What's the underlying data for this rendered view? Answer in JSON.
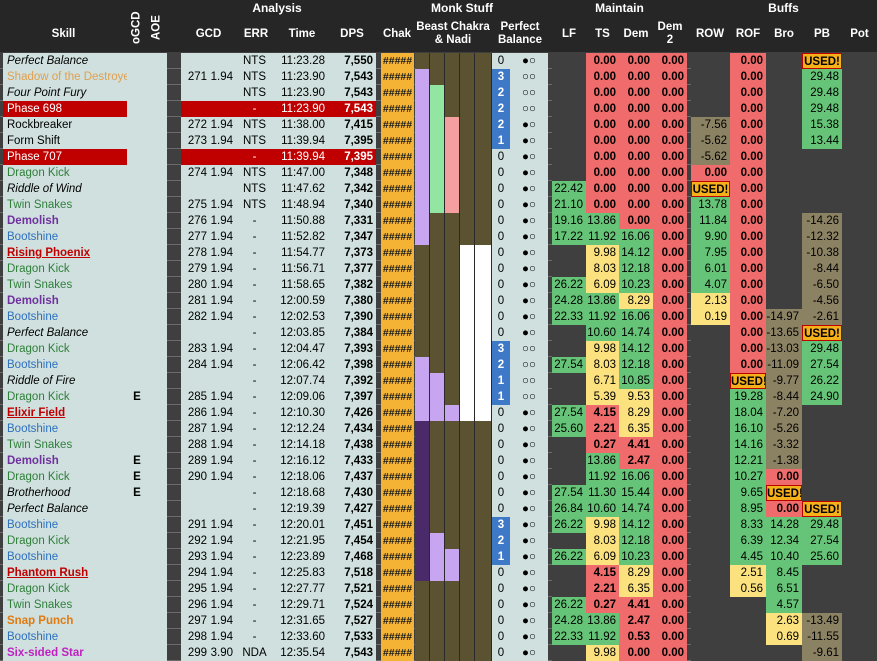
{
  "headers": {
    "groups": [
      "Analysis",
      "Monk Stuff",
      "Maintain",
      "Buffs"
    ],
    "skill": "Skill",
    "ogcd": "oGCD",
    "aoe": "AOE",
    "gcd": "GCD",
    "err": "ERR",
    "time": "Time",
    "dps": "DPS",
    "chak": "Chak",
    "beast": "Beast Chakra & Nadi",
    "perfect": "Perfect Balance",
    "lf": "LF",
    "ts": "TS",
    "dem": "Dem",
    "dem2": "Dem 2",
    "row": "ROW",
    "rof": "ROF",
    "bro": "Bro",
    "pb": "PB",
    "pot": "Pot"
  },
  "colors": {
    "phase": "#c00000",
    "red": "#f06b6b",
    "green": "#65c477",
    "gold": "#f5b335",
    "nadi_purple": "#c7a5f0",
    "nadi_green": "#93e6a2",
    "nadi_pink": "#f59fa0",
    "nadi_white": "#f2f2f2"
  },
  "rows": [
    {
      "skill": "Perfect Balance",
      "style": "italic",
      "ogcd": "",
      "gcdn": "",
      "gcd": "",
      "err": "NTS",
      "time": "11:23.28",
      "dps": "7,550",
      "chak": "#####",
      "nadi": [
        "",
        "",
        "",
        ""
      ],
      "pbn": "0",
      "pbd": "●○",
      "lf": "",
      "ts": "0.00",
      "dem": "0.00",
      "dem2": "0.00",
      "row": "",
      "rof": "0.00",
      "bro": "",
      "pb": "USED!",
      "pot": ""
    },
    {
      "skill": "Shadow of the Destroyer",
      "style": "shadow",
      "ogcd": "",
      "gcdn": "271",
      "gcd": "1.94",
      "err": "NTS",
      "time": "11:23.90",
      "dps": "7,543",
      "chak": "#####",
      "nadi": [
        "p",
        "",
        "",
        " "
      ],
      "pbn": "3",
      "pbd": "○○",
      "lf": "",
      "ts": "0.00",
      "dem": "0.00",
      "dem2": "0.00",
      "row": "",
      "rof": "0.00",
      "bro": "",
      "pb": "29.48",
      "pot": ""
    },
    {
      "skill": "Four Point Fury",
      "style": "italic",
      "ogcd": "",
      "gcdn": "",
      "gcd": "",
      "err": "NTS",
      "time": "11:23.90",
      "dps": "7,543",
      "chak": "#####",
      "nadi": [
        "p",
        "g",
        "",
        ""
      ],
      "pbn": "2",
      "pbd": "○○",
      "lf": "",
      "ts": "0.00",
      "dem": "0.00",
      "dem2": "0.00",
      "row": "",
      "rof": "0.00",
      "bro": "",
      "pb": "29.48",
      "pot": ""
    },
    {
      "skill": "Phase 698",
      "style": "phase",
      "ogcd": "",
      "gcdn": "",
      "gcd": "",
      "err": "-",
      "time": "11:23.90",
      "dps": "7,543",
      "chak": "#####",
      "nadi": [
        "p",
        "g",
        "",
        ""
      ],
      "pbn": "2",
      "pbd": "○○",
      "lf": "",
      "ts": "0.00",
      "dem": "0.00",
      "dem2": "0.00",
      "row": "",
      "rof": "0.00",
      "bro": "",
      "pb": "29.48",
      "pot": ""
    },
    {
      "skill": "Rockbreaker",
      "style": "normal",
      "ogcd": "",
      "gcdn": "272",
      "gcd": "1.94",
      "err": "NTS",
      "time": "11:38.00",
      "dps": "7,415",
      "chak": "#####",
      "nadi": [
        "p",
        "g",
        "k",
        ""
      ],
      "pbn": "2",
      "pbd": "●○",
      "lf": "",
      "ts": "0.00",
      "dem": "0.00",
      "dem2": "0.00",
      "row": "-7.56",
      "rof": "0.00",
      "bro": "",
      "pb": "15.38",
      "pot": ""
    },
    {
      "skill": "Form Shift",
      "style": "normal",
      "ogcd": "",
      "gcdn": "273",
      "gcd": "1.94",
      "err": "NTS",
      "time": "11:39.94",
      "dps": "7,395",
      "chak": "#####",
      "nadi": [
        "p",
        "g",
        "k",
        ""
      ],
      "pbn": "1",
      "pbd": "●○",
      "lf": "",
      "ts": "0.00",
      "dem": "0.00",
      "dem2": "0.00",
      "row": "-5.62",
      "rof": "0.00",
      "bro": "",
      "pb": "13.44",
      "pot": ""
    },
    {
      "skill": "Phase 707",
      "style": "phase",
      "ogcd": "",
      "gcdn": "",
      "gcd": "",
      "err": "-",
      "time": "11:39.94",
      "dps": "7,395",
      "chak": "#####",
      "nadi": [
        "p",
        "g",
        "k",
        ""
      ],
      "pbn": "0",
      "pbd": "●○",
      "lf": "",
      "ts": "0.00",
      "dem": "0.00",
      "dem2": "0.00",
      "row": "-5.62",
      "rof": "0.00",
      "bro": "",
      "pb": "",
      "pot": ""
    },
    {
      "skill": "Dragon Kick",
      "style": "green",
      "ogcd": "",
      "gcdn": "274",
      "gcd": "1.94",
      "err": "NTS",
      "time": "11:47.00",
      "dps": "7,348",
      "chak": "#####",
      "nadi": [
        "p",
        "g",
        "k",
        ""
      ],
      "pbn": "0",
      "pbd": "●○",
      "lf": "",
      "ts": "0.00",
      "dem": "0.00",
      "dem2": "0.00",
      "row": "0.00",
      "rof": "0.00",
      "bro": "",
      "pb": "",
      "pot": ""
    },
    {
      "skill": "Riddle of Wind",
      "style": "italic",
      "ogcd": "",
      "gcdn": "",
      "gcd": "",
      "err": "NTS",
      "time": "11:47.62",
      "dps": "7,342",
      "chak": "#####",
      "nadi": [
        "p",
        "g",
        "k",
        ""
      ],
      "pbn": "0",
      "pbd": "●○",
      "lf": "22.42",
      "ts": "0.00",
      "dem": "0.00",
      "dem2": "0.00",
      "row": "USED!",
      "rof": "0.00",
      "bro": "",
      "pb": "",
      "pot": ""
    },
    {
      "skill": "Twin Snakes",
      "style": "green",
      "ogcd": "",
      "gcdn": "275",
      "gcd": "1.94",
      "err": "NTS",
      "time": "11:48.94",
      "dps": "7,340",
      "chak": "#####",
      "nadi": [
        "p",
        "g",
        "k",
        ""
      ],
      "pbn": "0",
      "pbd": "●○",
      "lf": "21.10",
      "ts": "0.00",
      "dem": "0.00",
      "dem2": "0.00",
      "row": "13.78",
      "rof": "0.00",
      "bro": "",
      "pb": "",
      "pot": ""
    },
    {
      "skill": "Demolish",
      "style": "purple",
      "ogcd": "",
      "gcdn": "276",
      "gcd": "1.94",
      "err": "-",
      "time": "11:50.88",
      "dps": "7,331",
      "chak": "#####",
      "nadi": [
        "p",
        "",
        "",
        ""
      ],
      "pbn": "0",
      "pbd": "●○",
      "lf": "19.16",
      "ts": "13.86",
      "dem": "0.00",
      "dem2": "0.00",
      "row": "11.84",
      "rof": "0.00",
      "bro": "",
      "pb": "-14.26",
      "pot": ""
    },
    {
      "skill": "Bootshine",
      "style": "blue",
      "ogcd": "",
      "gcdn": "277",
      "gcd": "1.94",
      "err": "-",
      "time": "11:52.82",
      "dps": "7,347",
      "chak": "#####",
      "nadi": [
        "p",
        "",
        "",
        ""
      ],
      "pbn": "0",
      "pbd": "●○",
      "lf": "17.22",
      "ts": "11.92",
      "dem": "16.06",
      "dem2": "0.00",
      "row": "9.90",
      "rof": "0.00",
      "bro": "",
      "pb": "-12.32",
      "pot": ""
    },
    {
      "skill": "Rising Phoenix",
      "style": "redbold",
      "ogcd": "",
      "gcdn": "278",
      "gcd": "1.94",
      "err": "-",
      "time": "11:54.77",
      "dps": "7,373",
      "chak": "#####",
      "nadi": [
        "",
        "",
        "",
        "w"
      ],
      "pbn": "0",
      "pbd": "●○",
      "lf": "",
      "ts": "9.98",
      "dem": "14.12",
      "dem2": "0.00",
      "row": "7.95",
      "rof": "0.00",
      "bro": "",
      "pb": "-10.38",
      "pot": ""
    },
    {
      "skill": "Dragon Kick",
      "style": "green",
      "ogcd": "",
      "gcdn": "279",
      "gcd": "1.94",
      "err": "-",
      "time": "11:56.71",
      "dps": "7,377",
      "chak": "#####",
      "nadi": [
        "",
        "",
        "",
        "w"
      ],
      "pbn": "0",
      "pbd": "●○",
      "lf": "",
      "ts": "8.03",
      "dem": "12.18",
      "dem2": "0.00",
      "row": "6.01",
      "rof": "0.00",
      "bro": "",
      "pb": "-8.44",
      "pot": ""
    },
    {
      "skill": "Twin Snakes",
      "style": "green",
      "ogcd": "",
      "gcdn": "280",
      "gcd": "1.94",
      "err": "-",
      "time": "11:58.65",
      "dps": "7,382",
      "chak": "#####",
      "nadi": [
        "",
        "",
        "",
        "w"
      ],
      "pbn": "0",
      "pbd": "●○",
      "lf": "26.22",
      "ts": "6.09",
      "dem": "10.23",
      "dem2": "0.00",
      "row": "4.07",
      "rof": "0.00",
      "bro": "",
      "pb": "-6.50",
      "pot": ""
    },
    {
      "skill": "Demolish",
      "style": "purple",
      "ogcd": "",
      "gcdn": "281",
      "gcd": "1.94",
      "err": "-",
      "time": "12:00.59",
      "dps": "7,380",
      "chak": "#####",
      "nadi": [
        "",
        "",
        "",
        "w"
      ],
      "pbn": "0",
      "pbd": "●○",
      "lf": "24.28",
      "ts": "13.86",
      "dem": "8.29",
      "dem2": "0.00",
      "row": "2.13",
      "rof": "0.00",
      "bro": "",
      "pb": "-4.56",
      "pot": ""
    },
    {
      "skill": "Bootshine",
      "style": "blue",
      "ogcd": "",
      "gcdn": "282",
      "gcd": "1.94",
      "err": "-",
      "time": "12:02.53",
      "dps": "7,390",
      "chak": "#####",
      "nadi": [
        "",
        "",
        "",
        "w"
      ],
      "pbn": "0",
      "pbd": "●○",
      "lf": "22.33",
      "ts": "11.92",
      "dem": "16.06",
      "dem2": "0.00",
      "row": "0.19",
      "rof": "0.00",
      "bro": "-14.97",
      "pb": "-2.61",
      "pot": ""
    },
    {
      "skill": "Perfect Balance",
      "style": "italic",
      "ogcd": "",
      "gcdn": "",
      "gcd": "",
      "err": "-",
      "time": "12:03.85",
      "dps": "7,384",
      "chak": "#####",
      "nadi": [
        "",
        "",
        "",
        "w"
      ],
      "pbn": "0",
      "pbd": "●○",
      "lf": "",
      "ts": "10.60",
      "dem": "14.74",
      "dem2": "0.00",
      "row": "",
      "rof": "0.00",
      "bro": "-13.65",
      "pb": "USED!",
      "pot": ""
    },
    {
      "skill": "Dragon Kick",
      "style": "green",
      "ogcd": "",
      "gcdn": "283",
      "gcd": "1.94",
      "err": "-",
      "time": "12:04.47",
      "dps": "7,393",
      "chak": "#####",
      "nadi": [
        "",
        "",
        "",
        "w"
      ],
      "pbn": "3",
      "pbd": "○○",
      "lf": "",
      "ts": "9.98",
      "dem": "14.12",
      "dem2": "0.00",
      "row": "",
      "rof": "0.00",
      "bro": "-13.03",
      "pb": "29.48",
      "pot": ""
    },
    {
      "skill": "Bootshine",
      "style": "blue",
      "ogcd": "",
      "gcdn": "284",
      "gcd": "1.94",
      "err": "-",
      "time": "12:06.42",
      "dps": "7,398",
      "chak": "#####",
      "nadi": [
        "p",
        "",
        "",
        "w"
      ],
      "pbn": "2",
      "pbd": "○○",
      "lf": "27.54",
      "ts": "8.03",
      "dem": "12.18",
      "dem2": "0.00",
      "row": "",
      "rof": "0.00",
      "bro": "-11.09",
      "pb": "27.54",
      "pot": ""
    },
    {
      "skill": "Riddle of Fire",
      "style": "italic",
      "ogcd": "",
      "gcdn": "",
      "gcd": "",
      "err": "-",
      "time": "12:07.74",
      "dps": "7,392",
      "chak": "#####",
      "nadi": [
        "p",
        "p",
        "",
        "w"
      ],
      "pbn": "1",
      "pbd": "○○",
      "lf": "",
      "ts": "6.71",
      "dem": "10.85",
      "dem2": "0.00",
      "row": "",
      "rof": "USED!",
      "bro": "-9.77",
      "pb": "26.22",
      "pot": ""
    },
    {
      "skill": "Dragon Kick",
      "style": "green",
      "ogcd": "E",
      "gcdn": "285",
      "gcd": "1.94",
      "err": "-",
      "time": "12:09.06",
      "dps": "7,397",
      "chak": "#####",
      "nadi": [
        "p",
        "p",
        "",
        "w"
      ],
      "pbn": "1",
      "pbd": "○○",
      "lf": "",
      "ts": "5.39",
      "dem": "9.53",
      "dem2": "0.00",
      "row": "",
      "rof": "19.28",
      "bro": "-8.44",
      "pb": "24.90",
      "pot": ""
    },
    {
      "skill": "Elixir Field",
      "style": "redbold",
      "ogcd": "",
      "gcdn": "286",
      "gcd": "1.94",
      "err": "-",
      "time": "12:10.30",
      "dps": "7,426",
      "chak": "#####",
      "nadi": [
        "p",
        "p",
        "p",
        "w"
      ],
      "pbn": "0",
      "pbd": "●○",
      "lf": "27.54",
      "ts": "4.15",
      "dem": "8.29",
      "dem2": "0.00",
      "row": "",
      "rof": "18.04",
      "bro": "-7.20",
      "pb": "",
      "pot": ""
    },
    {
      "skill": "Bootshine",
      "style": "blue",
      "ogcd": "",
      "gcdn": "287",
      "gcd": "1.94",
      "err": "-",
      "time": "12:12.24",
      "dps": "7,434",
      "chak": "#####",
      "nadi": [
        "d",
        "",
        "",
        ""
      ],
      "pbn": "0",
      "pbd": "●○",
      "lf": "25.60",
      "ts": "2.21",
      "dem": "6.35",
      "dem2": "0.00",
      "row": "",
      "rof": "16.10",
      "bro": "-5.26",
      "pb": "",
      "pot": ""
    },
    {
      "skill": "Twin Snakes",
      "style": "green",
      "ogcd": "",
      "gcdn": "288",
      "gcd": "1.94",
      "err": "-",
      "time": "12:14.18",
      "dps": "7,438",
      "chak": "#####",
      "nadi": [
        "d",
        "",
        "",
        ""
      ],
      "pbn": "0",
      "pbd": "●○",
      "lf": "",
      "ts": "0.27",
      "dem": "4.41",
      "dem2": "0.00",
      "row": "",
      "rof": "14.16",
      "bro": "-3.32",
      "pb": "",
      "pot": ""
    },
    {
      "skill": "Demolish",
      "style": "purple",
      "ogcd": "E",
      "gcdn": "289",
      "gcd": "1.94",
      "err": "-",
      "time": "12:16.12",
      "dps": "7,433",
      "chak": "#####",
      "nadi": [
        "d",
        "",
        "",
        ""
      ],
      "pbn": "0",
      "pbd": "●○",
      "lf": "",
      "ts": "13.86",
      "dem": "2.47",
      "dem2": "0.00",
      "row": "",
      "rof": "12.21",
      "bro": "-1.38",
      "pb": "",
      "pot": ""
    },
    {
      "skill": "Dragon Kick",
      "style": "green",
      "ogcd": "E",
      "gcdn": "290",
      "gcd": "1.94",
      "err": "-",
      "time": "12:18.06",
      "dps": "7,437",
      "chak": "#####",
      "nadi": [
        "d",
        "",
        "",
        ""
      ],
      "pbn": "0",
      "pbd": "●○",
      "lf": "",
      "ts": "11.92",
      "dem": "16.06",
      "dem2": "0.00",
      "row": "",
      "rof": "10.27",
      "bro": "0.00",
      "pb": "",
      "pot": ""
    },
    {
      "skill": "Brotherhood",
      "style": "italic",
      "ogcd": "E",
      "gcdn": "",
      "gcd": "",
      "err": "-",
      "time": "12:18.68",
      "dps": "7,430",
      "chak": "#####",
      "nadi": [
        "d",
        "",
        "",
        ""
      ],
      "pbn": "0",
      "pbd": "●○",
      "lf": "27.54",
      "ts": "11.30",
      "dem": "15.44",
      "dem2": "0.00",
      "row": "",
      "rof": "9.65",
      "bro": "USED!",
      "pb": "",
      "pot": ""
    },
    {
      "skill": "Perfect Balance",
      "style": "italic",
      "ogcd": "",
      "gcdn": "",
      "gcd": "",
      "err": "-",
      "time": "12:19.39",
      "dps": "7,427",
      "chak": "#####",
      "nadi": [
        "d",
        "",
        "",
        ""
      ],
      "pbn": "0",
      "pbd": "●○",
      "lf": "26.84",
      "ts": "10.60",
      "dem": "14.74",
      "dem2": "0.00",
      "row": "",
      "rof": "8.95",
      "bro": "0.00",
      "pb": "USED!",
      "pot": ""
    },
    {
      "skill": "Bootshine",
      "style": "blue",
      "ogcd": "",
      "gcdn": "291",
      "gcd": "1.94",
      "err": "-",
      "time": "12:20.01",
      "dps": "7,451",
      "chak": "#####",
      "nadi": [
        "d",
        "",
        "",
        ""
      ],
      "pbn": "3",
      "pbd": "●○",
      "lf": "26.22",
      "ts": "9.98",
      "dem": "14.12",
      "dem2": "0.00",
      "row": "",
      "rof": "8.33",
      "bro": "14.28",
      "pb": "29.48",
      "pot": ""
    },
    {
      "skill": "Dragon Kick",
      "style": "green",
      "ogcd": "",
      "gcdn": "292",
      "gcd": "1.94",
      "err": "-",
      "time": "12:21.95",
      "dps": "7,454",
      "chak": "#####",
      "nadi": [
        "d",
        "p",
        "",
        ""
      ],
      "pbn": "2",
      "pbd": "●○",
      "lf": "",
      "ts": "8.03",
      "dem": "12.18",
      "dem2": "0.00",
      "row": "",
      "rof": "6.39",
      "bro": "12.34",
      "pb": "27.54",
      "pot": ""
    },
    {
      "skill": "Bootshine",
      "style": "blue",
      "ogcd": "",
      "gcdn": "293",
      "gcd": "1.94",
      "err": "-",
      "time": "12:23.89",
      "dps": "7,468",
      "chak": "#####",
      "nadi": [
        "d",
        "p",
        "p",
        ""
      ],
      "pbn": "1",
      "pbd": "●○",
      "lf": "26.22",
      "ts": "6.09",
      "dem": "10.23",
      "dem2": "0.00",
      "row": "",
      "rof": "4.45",
      "bro": "10.40",
      "pb": "25.60",
      "pot": ""
    },
    {
      "skill": "Phantom Rush",
      "style": "redbold",
      "ogcd": "",
      "gcdn": "294",
      "gcd": "1.94",
      "err": "-",
      "time": "12:25.83",
      "dps": "7,518",
      "chak": "#####",
      "nadi": [
        "d",
        "p",
        "p",
        ""
      ],
      "pbn": "0",
      "pbd": "●○",
      "lf": "",
      "ts": "4.15",
      "dem": "8.29",
      "dem2": "0.00",
      "row": "",
      "rof": "2.51",
      "bro": "8.45",
      "pb": "",
      "pot": ""
    },
    {
      "skill": "Dragon Kick",
      "style": "green",
      "ogcd": "",
      "gcdn": "295",
      "gcd": "1.94",
      "err": "-",
      "time": "12:27.77",
      "dps": "7,521",
      "chak": "#####",
      "nadi": [
        "",
        "",
        "",
        ""
      ],
      "pbn": "0",
      "pbd": "●○",
      "lf": "",
      "ts": "2.21",
      "dem": "6.35",
      "dem2": "0.00",
      "row": "",
      "rof": "0.56",
      "bro": "6.51",
      "pb": "",
      "pot": ""
    },
    {
      "skill": "Twin Snakes",
      "style": "green",
      "ogcd": "",
      "gcdn": "296",
      "gcd": "1.94",
      "err": "-",
      "time": "12:29.71",
      "dps": "7,524",
      "chak": "#####",
      "nadi": [
        "",
        "",
        "",
        ""
      ],
      "pbn": "0",
      "pbd": "●○",
      "lf": "26.22",
      "ts": "0.27",
      "dem": "4.41",
      "dem2": "0.00",
      "row": "",
      "rof": "",
      "bro": "4.57",
      "pb": "",
      "pot": ""
    },
    {
      "skill": "Snap Punch",
      "style": "orange",
      "ogcd": "",
      "gcdn": "297",
      "gcd": "1.94",
      "err": "-",
      "time": "12:31.65",
      "dps": "7,527",
      "chak": "#####",
      "nadi": [
        "",
        "",
        "",
        ""
      ],
      "pbn": "0",
      "pbd": "●○",
      "lf": "24.28",
      "ts": "13.86",
      "dem": "2.47",
      "dem2": "0.00",
      "row": "",
      "rof": "",
      "bro": "2.63",
      "pb": "-13.49",
      "pot": ""
    },
    {
      "skill": "Bootshine",
      "style": "blue",
      "ogcd": "",
      "gcdn": "298",
      "gcd": "1.94",
      "err": "-",
      "time": "12:33.60",
      "dps": "7,533",
      "chak": "#####",
      "nadi": [
        "",
        "",
        "",
        ""
      ],
      "pbn": "0",
      "pbd": "●○",
      "lf": "22.33",
      "ts": "11.92",
      "dem": "0.53",
      "dem2": "0.00",
      "row": "",
      "rof": "",
      "bro": "0.69",
      "pb": "-11.55",
      "pot": ""
    },
    {
      "skill": "Six-sided Star",
      "style": "magenta",
      "ogcd": "",
      "gcdn": "299",
      "gcd": "3.90",
      "err": "NDA",
      "time": "12:35.54",
      "dps": "7,543",
      "chak": "#####",
      "nadi": [
        "",
        "",
        "",
        ""
      ],
      "pbn": "0",
      "pbd": "●○",
      "lf": "",
      "ts": "9.98",
      "dem": "0.00",
      "dem2": "0.00",
      "row": "",
      "rof": "",
      "bro": "",
      "pb": "-9.61",
      "pot": ""
    }
  ]
}
